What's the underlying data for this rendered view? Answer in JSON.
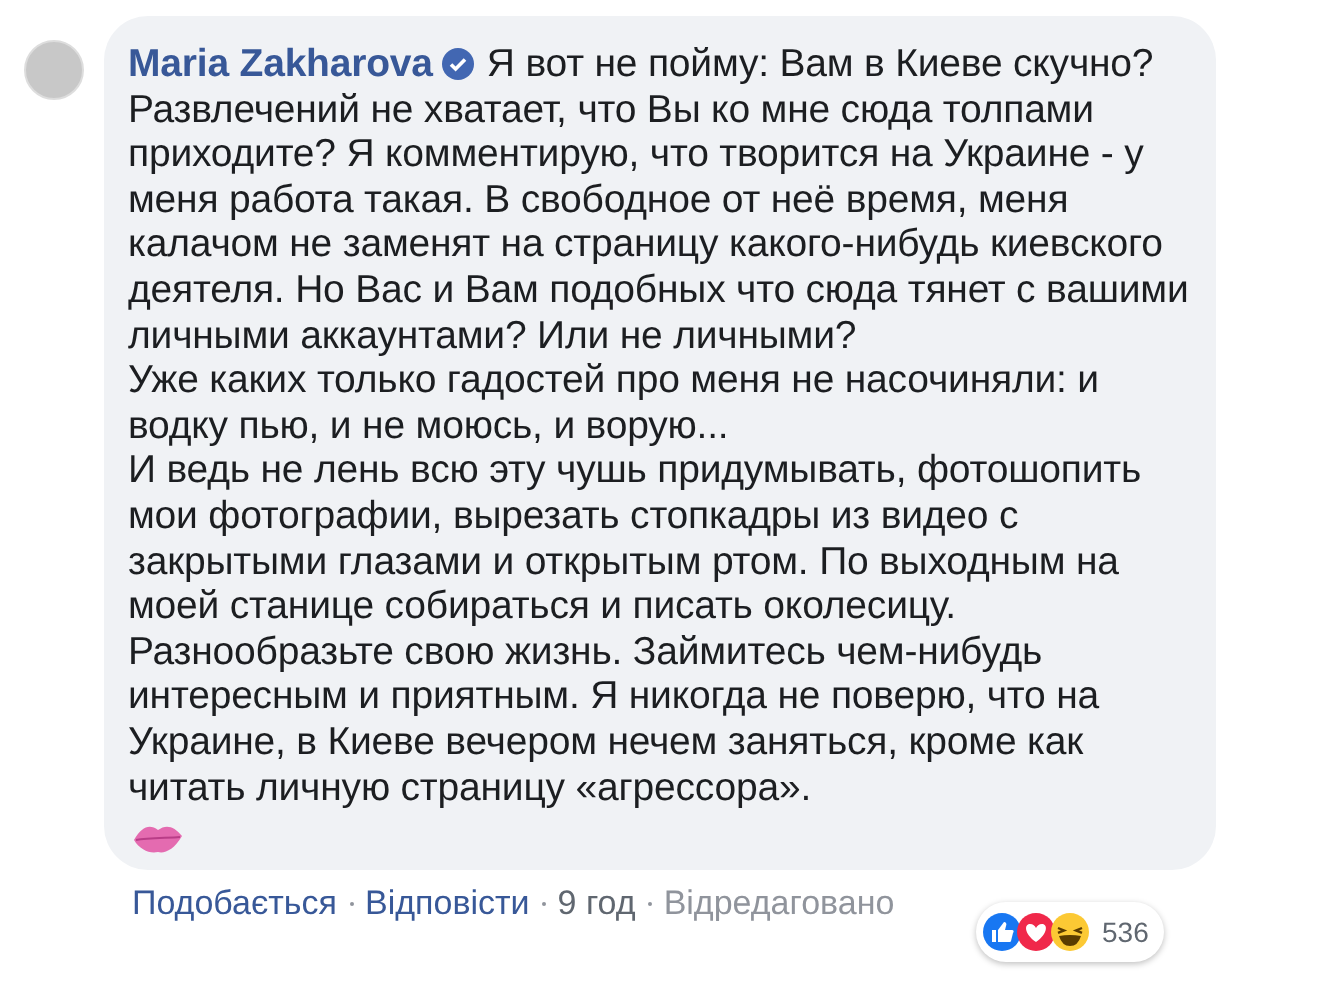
{
  "comment": {
    "author": "Maria Zakharova",
    "verified": true,
    "paragraphs": [
      "Я вот не пойму: Вам в Киеве скучно? Развлечений не хватает, что Вы ко мне сюда толпами приходите? Я комментирую, что творится на Украине - у меня работа такая. В свободное от неё время, меня калачом не заменят на страницу какого-нибудь киевского деятеля. Но Вас и Вам подобных что сюда тянет с вашими личными аккаунтами? Или не личными?",
      "Уже каких только гадостей про меня не насочиняли: и водку пью, и не моюсь, и ворую...",
      "И ведь не лень всю эту чушь придумывать, фотошопить мои фотографии, вырезать стопкадры из видео с закрытыми глазами и открытым ртом. По выходным на моей станице собираться и писать околесицу.",
      "Разнообразьте свою жизнь. Займитесь чем-нибудь интересным и приятным. Я никогда не поверю, что на Украине, в Киеве вечером нечем заняться, кроме как читать личную страницу «агрессора»."
    ],
    "actions": [
      {
        "label": "Подобається",
        "kind": "link"
      },
      {
        "label": "Відповісти",
        "kind": "link"
      },
      {
        "label": "9 год",
        "kind": "time"
      },
      {
        "label": "Відредаговано",
        "kind": "note"
      }
    ],
    "reaction_count": "536"
  }
}
